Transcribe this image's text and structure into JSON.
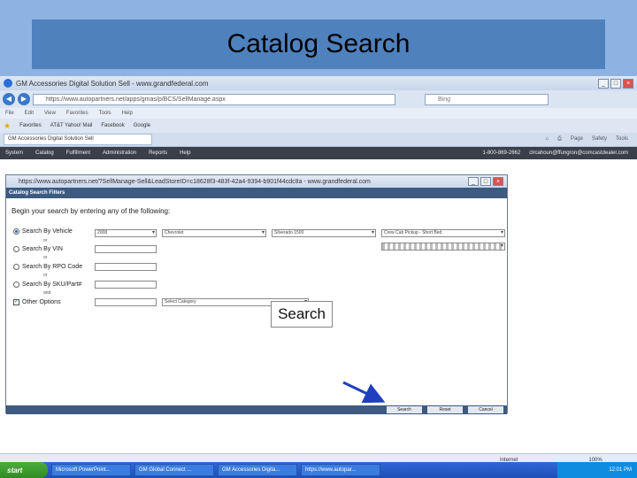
{
  "slide": {
    "title": "Catalog Search"
  },
  "browser": {
    "window_title": "GM Accessories Digital Solution Sell - www.grandfederal.com",
    "url": "https://www.autopartners.net/apps/gmas/p/BCS/SellManage.aspx",
    "search_placeholder": "Bing",
    "menu": [
      "File",
      "Edit",
      "View",
      "Favorites",
      "Tools",
      "Help"
    ],
    "favorites_label": "Favorites",
    "favorites": [
      "AT&T Yahoo! Mail",
      "Facebook",
      "Google"
    ],
    "tab_label": "GM Accessories Digital Solution Sell",
    "tab_tools": [
      "Page",
      "Safety",
      "Tools"
    ],
    "app_nav": [
      "System",
      "Catalog",
      "Fulfillment",
      "Administration",
      "Reports",
      "Help"
    ],
    "phone": "1-800-869-2662",
    "user_email": "clrcahoun@ffungron@comcastdealer.com"
  },
  "popup": {
    "title": "https://www.autopartners.net/?SellManage-Sell&LeadStoreID=c18628f3-483f-42a4-9394-b901f44cdc8a - www.grandfederal.com",
    "header": "Catalog Search Filters",
    "instruction": "Begin your search by entering any of the following:",
    "options": [
      {
        "label": "Search By Vehicle",
        "joiner": "or"
      },
      {
        "label": "Search By VIN",
        "joiner": "or"
      },
      {
        "label": "Search By RPO Code",
        "joiner": "or"
      },
      {
        "label": "Search By SKU/Part#",
        "joiner": "and"
      },
      {
        "label": "Other Options",
        "joiner": ""
      }
    ],
    "vehicle_year": "2008",
    "vehicle_make": "Chevrolet",
    "vehicle_model": "Silverado 1500",
    "vehicle_body": "Crew Cab Pickup - Short Bed",
    "vehicle_engine": "",
    "category_placeholder": "Select Category",
    "buttons": {
      "search": "Search",
      "reset": "Reset",
      "cancel": "Cancel"
    }
  },
  "callout": {
    "label": "Search"
  },
  "status": {
    "zone": "Internet",
    "zoom": "100%"
  },
  "taskbar": {
    "start": "start",
    "tasks": [
      "Microsoft PowerPoint...",
      "GM Global Connect ...",
      "GM Accessories Digita...",
      "https://www.autopar..."
    ],
    "clock": "12:01 PM"
  }
}
